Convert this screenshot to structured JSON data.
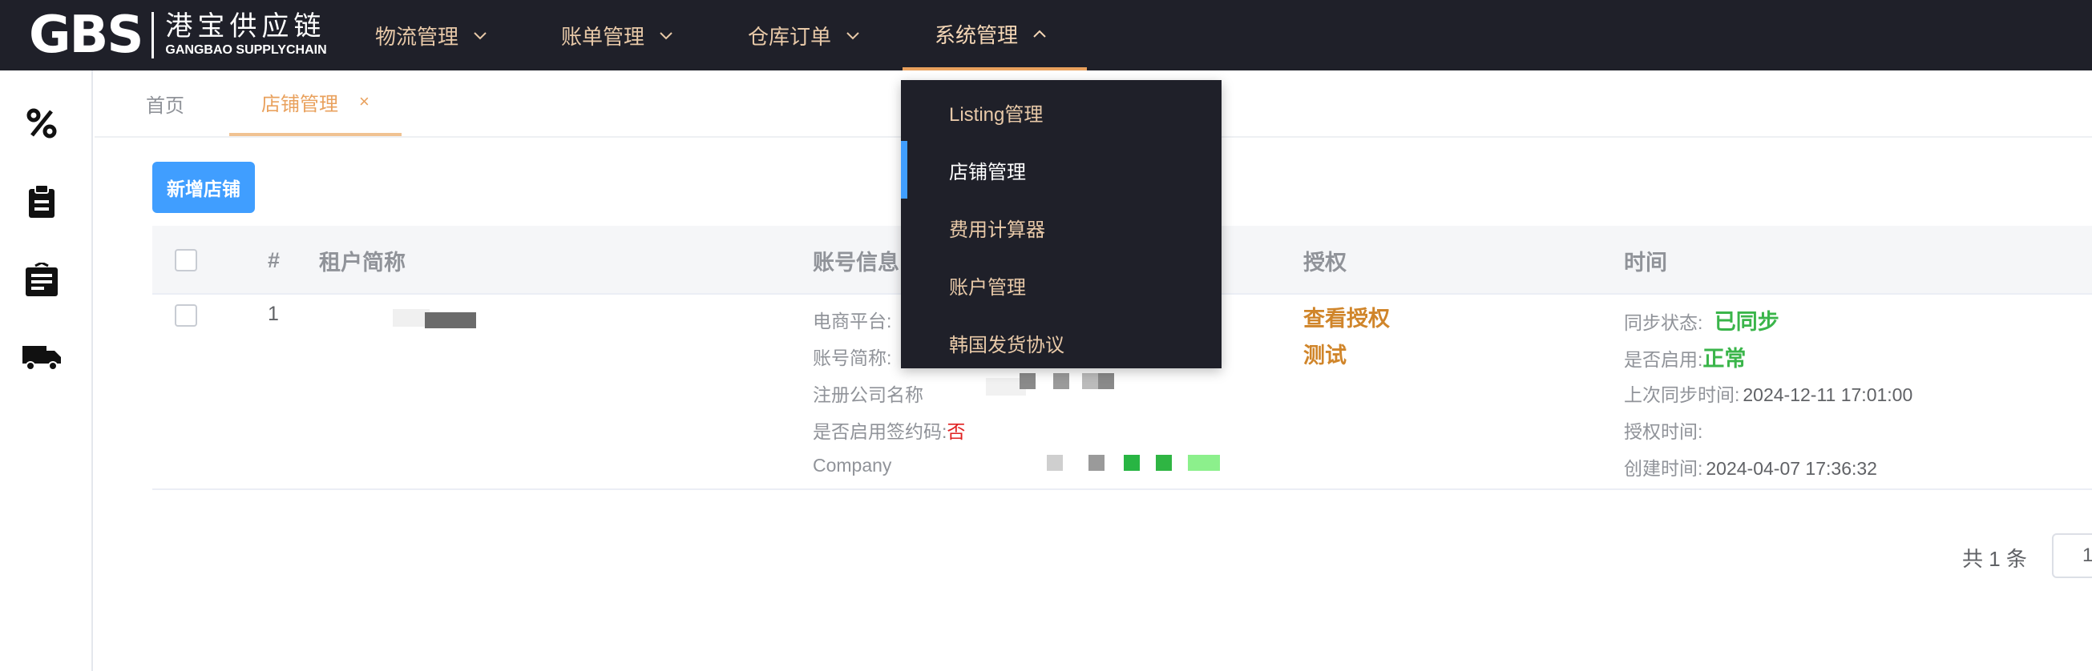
{
  "brand": {
    "logo_text": "GBS",
    "name_cn": "港宝供应链",
    "name_en": "GANGBAO SUPPLYCHAIN"
  },
  "nav": [
    {
      "label": "物流管理"
    },
    {
      "label": "账单管理"
    },
    {
      "label": "仓库订单"
    },
    {
      "label": "系统管理",
      "active": true
    }
  ],
  "rail_icons": [
    "percent-icon",
    "clipboard-icon",
    "document-list-icon",
    "truck-icon"
  ],
  "tabs": [
    {
      "label": "首页"
    },
    {
      "label": "店铺管理",
      "active": true,
      "close": "×"
    }
  ],
  "toolbar": {
    "add_label": "新增店铺"
  },
  "table": {
    "headers": {
      "index": "#",
      "tenant": "租户简称",
      "account": "账号信息",
      "auth": "授权",
      "time": "时间"
    },
    "row": {
      "index": "1",
      "account": {
        "platform_label": "电商平台:",
        "short_name_label": "账号简称:",
        "company_label": "注册公司名称",
        "sign_code_label": "是否启用签约码:",
        "sign_code_value": "否",
        "company_en_label": "Company"
      },
      "auth": {
        "view": "查看授权",
        "test": "测试"
      },
      "time": {
        "sync_label": "同步状态:",
        "sync_value": "已同步",
        "enabled_label": "是否启用:",
        "enabled_value": "正常",
        "last_sync_label": "上次同步时间:",
        "last_sync_value": "2024-12-11 17:01:00",
        "auth_time_label": "授权时间:",
        "created_label": "创建时间:",
        "created_value": "2024-04-07 17:36:32"
      }
    }
  },
  "dropdown": {
    "items": [
      {
        "label": "Listing管理"
      },
      {
        "label": "店铺管理",
        "active": true
      },
      {
        "label": "费用计算器"
      },
      {
        "label": "账户管理"
      },
      {
        "label": "韩国发货协议"
      }
    ]
  },
  "pagination": {
    "total": "共 1 条",
    "page": "1"
  },
  "colors": {
    "topbar": "#1f2029",
    "accent": "#e9a15d",
    "primary": "#409eff",
    "success": "#3ab54a",
    "danger": "#e02020"
  }
}
